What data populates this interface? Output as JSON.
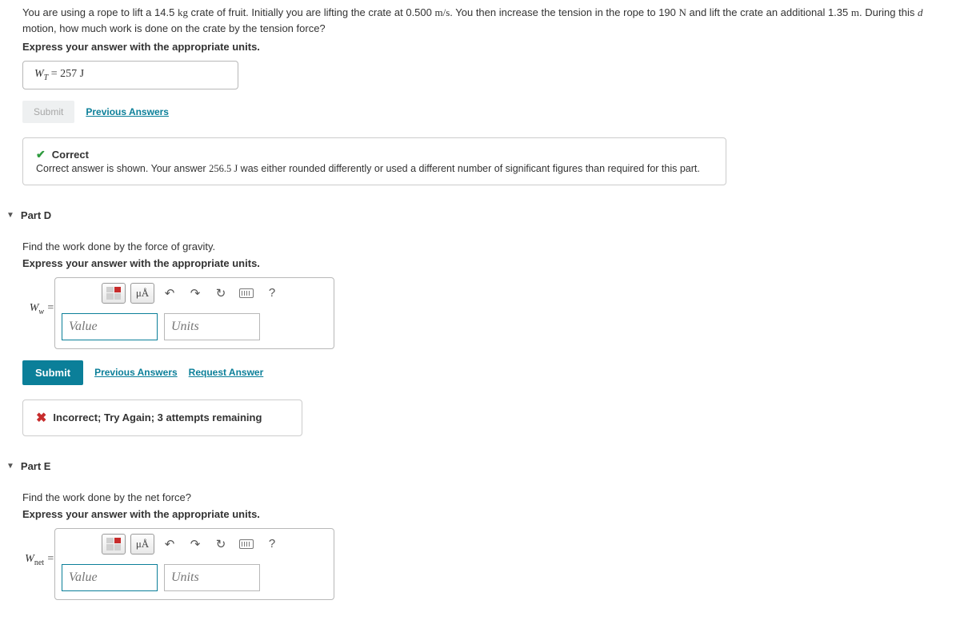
{
  "problem": {
    "text_parts": [
      "You are using a rope to lift a 14.5 ",
      "kg",
      " crate of fruit. Initially you are lifting the crate at 0.500 ",
      "m/s",
      ". You then increase the tension in the rope to 190 ",
      "N",
      " and lift the crate an additional 1.35 ",
      "m",
      ". During this ",
      "d",
      " motion, how much work is done on the crate by the tension force?"
    ],
    "instruct": "Express your answer with the appropriate units.",
    "answer_var": "W",
    "answer_sub": "T",
    "answer_eq": " = ",
    "answer_val": " 257 J"
  },
  "actions": {
    "submit_disabled": "Submit",
    "submit": "Submit",
    "prev": "Previous Answers",
    "request": "Request Answer"
  },
  "feedback_correct": {
    "title": "Correct",
    "body_pre": "Correct answer is shown. Your answer ",
    "body_val": "256.5 J",
    "body_post": " was either rounded differently or used a different number of significant figures than required for this part."
  },
  "partD": {
    "title": "Part D",
    "prompt": "Find the work done by the force of gravity.",
    "instruct": "Express your answer with the appropriate units.",
    "var": "W",
    "sub": "w",
    "eq": " = ",
    "value_ph": "Value",
    "units_ph": "Units",
    "feedback": "Incorrect; Try Again; 3 attempts remaining"
  },
  "partE": {
    "title": "Part E",
    "prompt": "Find the work done by the net force?",
    "instruct": "Express your answer with the appropriate units.",
    "var": "W",
    "sub": "net",
    "eq": " = ",
    "value_ph": "Value",
    "units_ph": "Units"
  },
  "toolbar": {
    "mu": "μÅ",
    "undo": "↶",
    "redo": "↷",
    "reset": "↻",
    "help": "?"
  }
}
